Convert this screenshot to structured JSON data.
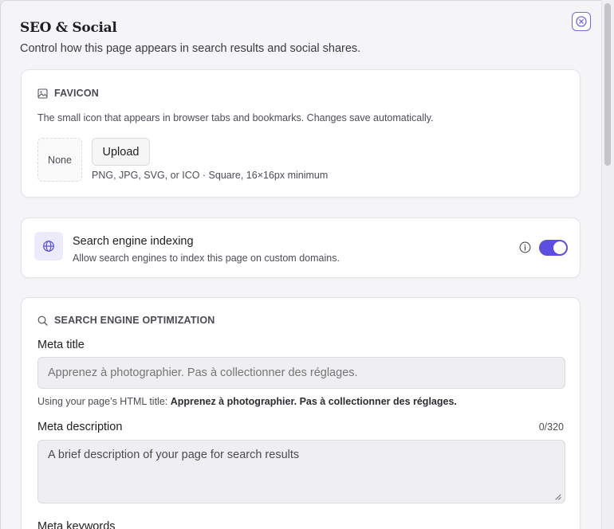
{
  "dialog": {
    "title": "SEO & Social",
    "subtitle": "Control how this page appears in search results and social shares."
  },
  "favicon": {
    "heading": "FAVICON",
    "description": "The small icon that appears in browser tabs and bookmarks. Changes save automatically.",
    "preview_label": "None",
    "upload_label": "Upload",
    "requirements": "PNG, JPG, SVG, or ICO · Square, 16×16px minimum"
  },
  "indexing": {
    "title": "Search engine indexing",
    "description": "Allow search engines to index this page on custom domains.",
    "enabled": true
  },
  "seo": {
    "heading": "SEARCH ENGINE OPTIMIZATION",
    "meta_title_label": "Meta title",
    "meta_title_placeholder": "Apprenez à photographier. Pas à collectionner des réglages.",
    "meta_title_hint_prefix": "Using your page’s HTML title: ",
    "meta_title_hint_value": "Apprenez à photographier. Pas à collectionner des réglages.",
    "meta_description_label": "Meta description",
    "meta_description_counter": "0/320",
    "meta_description_placeholder": "A brief description of your page for search results",
    "meta_keywords_label": "Meta keywords"
  },
  "colors": {
    "accent": "#5b4ee0",
    "accent_light": "#ecebfb"
  }
}
